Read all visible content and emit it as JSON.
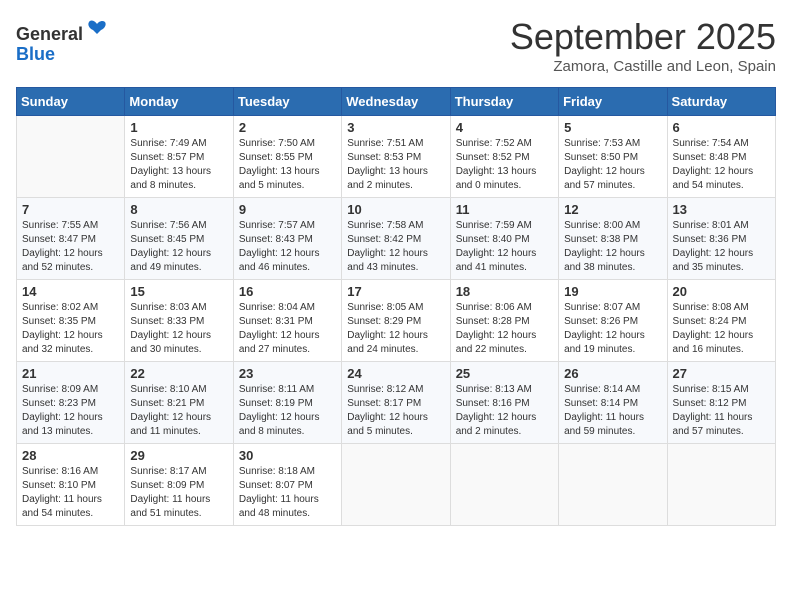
{
  "header": {
    "logo_line1": "General",
    "logo_line2": "Blue",
    "month_title": "September 2025",
    "location": "Zamora, Castille and Leon, Spain"
  },
  "calendar": {
    "days_of_week": [
      "Sunday",
      "Monday",
      "Tuesday",
      "Wednesday",
      "Thursday",
      "Friday",
      "Saturday"
    ],
    "weeks": [
      [
        {
          "day": null,
          "sunrise": null,
          "sunset": null,
          "daylight": null
        },
        {
          "day": "1",
          "sunrise": "Sunrise: 7:49 AM",
          "sunset": "Sunset: 8:57 PM",
          "daylight": "Daylight: 13 hours and 8 minutes."
        },
        {
          "day": "2",
          "sunrise": "Sunrise: 7:50 AM",
          "sunset": "Sunset: 8:55 PM",
          "daylight": "Daylight: 13 hours and 5 minutes."
        },
        {
          "day": "3",
          "sunrise": "Sunrise: 7:51 AM",
          "sunset": "Sunset: 8:53 PM",
          "daylight": "Daylight: 13 hours and 2 minutes."
        },
        {
          "day": "4",
          "sunrise": "Sunrise: 7:52 AM",
          "sunset": "Sunset: 8:52 PM",
          "daylight": "Daylight: 13 hours and 0 minutes."
        },
        {
          "day": "5",
          "sunrise": "Sunrise: 7:53 AM",
          "sunset": "Sunset: 8:50 PM",
          "daylight": "Daylight: 12 hours and 57 minutes."
        },
        {
          "day": "6",
          "sunrise": "Sunrise: 7:54 AM",
          "sunset": "Sunset: 8:48 PM",
          "daylight": "Daylight: 12 hours and 54 minutes."
        }
      ],
      [
        {
          "day": "7",
          "sunrise": "Sunrise: 7:55 AM",
          "sunset": "Sunset: 8:47 PM",
          "daylight": "Daylight: 12 hours and 52 minutes."
        },
        {
          "day": "8",
          "sunrise": "Sunrise: 7:56 AM",
          "sunset": "Sunset: 8:45 PM",
          "daylight": "Daylight: 12 hours and 49 minutes."
        },
        {
          "day": "9",
          "sunrise": "Sunrise: 7:57 AM",
          "sunset": "Sunset: 8:43 PM",
          "daylight": "Daylight: 12 hours and 46 minutes."
        },
        {
          "day": "10",
          "sunrise": "Sunrise: 7:58 AM",
          "sunset": "Sunset: 8:42 PM",
          "daylight": "Daylight: 12 hours and 43 minutes."
        },
        {
          "day": "11",
          "sunrise": "Sunrise: 7:59 AM",
          "sunset": "Sunset: 8:40 PM",
          "daylight": "Daylight: 12 hours and 41 minutes."
        },
        {
          "day": "12",
          "sunrise": "Sunrise: 8:00 AM",
          "sunset": "Sunset: 8:38 PM",
          "daylight": "Daylight: 12 hours and 38 minutes."
        },
        {
          "day": "13",
          "sunrise": "Sunrise: 8:01 AM",
          "sunset": "Sunset: 8:36 PM",
          "daylight": "Daylight: 12 hours and 35 minutes."
        }
      ],
      [
        {
          "day": "14",
          "sunrise": "Sunrise: 8:02 AM",
          "sunset": "Sunset: 8:35 PM",
          "daylight": "Daylight: 12 hours and 32 minutes."
        },
        {
          "day": "15",
          "sunrise": "Sunrise: 8:03 AM",
          "sunset": "Sunset: 8:33 PM",
          "daylight": "Daylight: 12 hours and 30 minutes."
        },
        {
          "day": "16",
          "sunrise": "Sunrise: 8:04 AM",
          "sunset": "Sunset: 8:31 PM",
          "daylight": "Daylight: 12 hours and 27 minutes."
        },
        {
          "day": "17",
          "sunrise": "Sunrise: 8:05 AM",
          "sunset": "Sunset: 8:29 PM",
          "daylight": "Daylight: 12 hours and 24 minutes."
        },
        {
          "day": "18",
          "sunrise": "Sunrise: 8:06 AM",
          "sunset": "Sunset: 8:28 PM",
          "daylight": "Daylight: 12 hours and 22 minutes."
        },
        {
          "day": "19",
          "sunrise": "Sunrise: 8:07 AM",
          "sunset": "Sunset: 8:26 PM",
          "daylight": "Daylight: 12 hours and 19 minutes."
        },
        {
          "day": "20",
          "sunrise": "Sunrise: 8:08 AM",
          "sunset": "Sunset: 8:24 PM",
          "daylight": "Daylight: 12 hours and 16 minutes."
        }
      ],
      [
        {
          "day": "21",
          "sunrise": "Sunrise: 8:09 AM",
          "sunset": "Sunset: 8:23 PM",
          "daylight": "Daylight: 12 hours and 13 minutes."
        },
        {
          "day": "22",
          "sunrise": "Sunrise: 8:10 AM",
          "sunset": "Sunset: 8:21 PM",
          "daylight": "Daylight: 12 hours and 11 minutes."
        },
        {
          "day": "23",
          "sunrise": "Sunrise: 8:11 AM",
          "sunset": "Sunset: 8:19 PM",
          "daylight": "Daylight: 12 hours and 8 minutes."
        },
        {
          "day": "24",
          "sunrise": "Sunrise: 8:12 AM",
          "sunset": "Sunset: 8:17 PM",
          "daylight": "Daylight: 12 hours and 5 minutes."
        },
        {
          "day": "25",
          "sunrise": "Sunrise: 8:13 AM",
          "sunset": "Sunset: 8:16 PM",
          "daylight": "Daylight: 12 hours and 2 minutes."
        },
        {
          "day": "26",
          "sunrise": "Sunrise: 8:14 AM",
          "sunset": "Sunset: 8:14 PM",
          "daylight": "Daylight: 11 hours and 59 minutes."
        },
        {
          "day": "27",
          "sunrise": "Sunrise: 8:15 AM",
          "sunset": "Sunset: 8:12 PM",
          "daylight": "Daylight: 11 hours and 57 minutes."
        }
      ],
      [
        {
          "day": "28",
          "sunrise": "Sunrise: 8:16 AM",
          "sunset": "Sunset: 8:10 PM",
          "daylight": "Daylight: 11 hours and 54 minutes."
        },
        {
          "day": "29",
          "sunrise": "Sunrise: 8:17 AM",
          "sunset": "Sunset: 8:09 PM",
          "daylight": "Daylight: 11 hours and 51 minutes."
        },
        {
          "day": "30",
          "sunrise": "Sunrise: 8:18 AM",
          "sunset": "Sunset: 8:07 PM",
          "daylight": "Daylight: 11 hours and 48 minutes."
        },
        {
          "day": null,
          "sunrise": null,
          "sunset": null,
          "daylight": null
        },
        {
          "day": null,
          "sunrise": null,
          "sunset": null,
          "daylight": null
        },
        {
          "day": null,
          "sunrise": null,
          "sunset": null,
          "daylight": null
        },
        {
          "day": null,
          "sunrise": null,
          "sunset": null,
          "daylight": null
        }
      ]
    ]
  }
}
